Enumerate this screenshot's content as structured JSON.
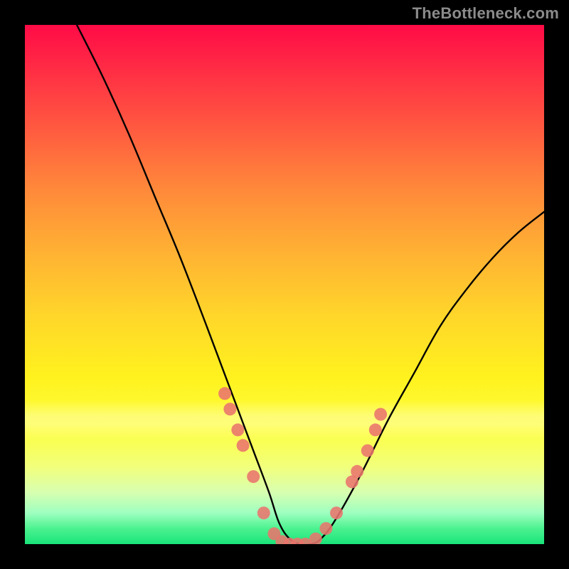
{
  "watermark": {
    "text": "TheBottleneck.com"
  },
  "chart_data": {
    "type": "line",
    "title": "",
    "xlabel": "",
    "ylabel": "",
    "xlim": [
      0,
      100
    ],
    "ylim": [
      0,
      100
    ],
    "grid": false,
    "legend": false,
    "series": [
      {
        "name": "bottleneck-curve",
        "color": "#000000",
        "x": [
          10,
          15,
          20,
          25,
          30,
          35,
          38,
          41,
          44,
          47,
          49,
          51,
          53,
          55,
          57,
          60,
          65,
          70,
          75,
          80,
          85,
          90,
          95,
          100
        ],
        "y": [
          100,
          90,
          79,
          67,
          55,
          42,
          34,
          26,
          18,
          10,
          4,
          1,
          0,
          0,
          1,
          5,
          14,
          24,
          33,
          42,
          49,
          55,
          60,
          64
        ]
      }
    ],
    "markers": [
      {
        "name": "highlight-dots",
        "color": "#e9746d",
        "points": [
          {
            "x": 38.5,
            "y": 29
          },
          {
            "x": 39.5,
            "y": 26
          },
          {
            "x": 41.0,
            "y": 22
          },
          {
            "x": 42.0,
            "y": 19
          },
          {
            "x": 44.0,
            "y": 13
          },
          {
            "x": 46.0,
            "y": 6
          },
          {
            "x": 48.0,
            "y": 2
          },
          {
            "x": 49.5,
            "y": 0.5
          },
          {
            "x": 51.0,
            "y": 0
          },
          {
            "x": 52.5,
            "y": 0
          },
          {
            "x": 54.0,
            "y": 0
          },
          {
            "x": 56.0,
            "y": 1
          },
          {
            "x": 58.0,
            "y": 3
          },
          {
            "x": 60.0,
            "y": 6
          },
          {
            "x": 63.0,
            "y": 12
          },
          {
            "x": 64.0,
            "y": 14
          },
          {
            "x": 66.0,
            "y": 18
          },
          {
            "x": 67.5,
            "y": 22
          },
          {
            "x": 68.5,
            "y": 25
          }
        ]
      }
    ],
    "background_bands": [
      {
        "name": "red-to-green-gradient",
        "from_y": 0,
        "to_y": 100
      },
      {
        "name": "pale-yellow-band",
        "from_y": 20,
        "to_y": 28
      }
    ]
  }
}
